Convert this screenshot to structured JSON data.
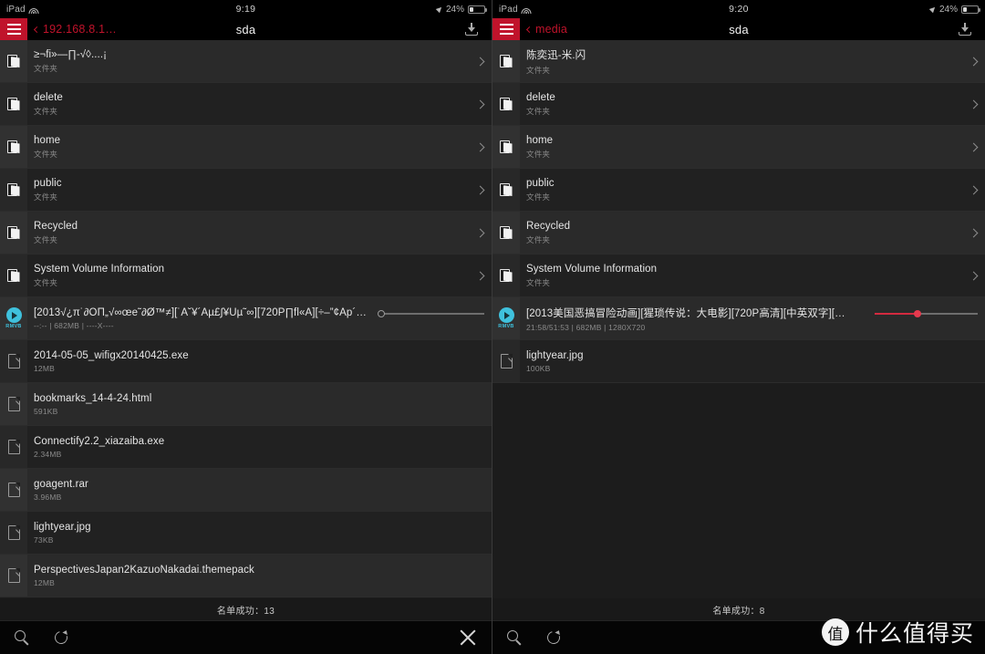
{
  "panels": [
    {
      "id": "left",
      "statusbar": {
        "device": "iPad",
        "wifi_icon": "wifi-icon",
        "time": "9:19",
        "location_icon": "location-arrow-icon",
        "battery_percent": "24%",
        "battery_level": 24
      },
      "navbar": {
        "menu_icon": "hamburger-menu-icon",
        "back_label": "192.168.8.1…",
        "title": "sda",
        "download_icon": "download-icon"
      },
      "rows": [
        {
          "type": "folder",
          "name": "≥¬fi»—∏-√◊....¡",
          "meta": "文件夹",
          "chevron": true
        },
        {
          "type": "folder",
          "name": "delete",
          "meta": "文件夹",
          "chevron": true
        },
        {
          "type": "folder",
          "name": "home",
          "meta": "文件夹",
          "chevron": true
        },
        {
          "type": "folder",
          "name": "public",
          "meta": "文件夹",
          "chevron": true
        },
        {
          "type": "folder",
          "name": "Recycled",
          "meta": "文件夹",
          "chevron": true
        },
        {
          "type": "folder",
          "name": "System Volume Information",
          "meta": "文件夹",
          "chevron": true
        },
        {
          "type": "video",
          "format": "RMVB",
          "name": "[2013√¿π˙∂ÒΠ„√∞œe˜∂Ø™≠][˙À˘¥´Àµ£∫¥Ûµ˜∞][720P∏fl«Â][÷–”¢Àp´…",
          "meta": "--:-- | 682MB | ----X----",
          "slider": {
            "active": false,
            "percent": 0
          }
        },
        {
          "type": "file",
          "name": "2014-05-05_wifigx20140425.exe",
          "meta": "12MB"
        },
        {
          "type": "file",
          "name": "bookmarks_14-4-24.html",
          "meta": "591KB"
        },
        {
          "type": "file",
          "name": "Connectify2.2_xiazaiba.exe",
          "meta": "2.34MB"
        },
        {
          "type": "file",
          "name": "goagent.rar",
          "meta": "3.96MB"
        },
        {
          "type": "file",
          "name": "lightyear.jpg",
          "meta": "73KB"
        },
        {
          "type": "file",
          "name": "PerspectivesJapan2KazuoNakadai.themepack",
          "meta": "12MB"
        }
      ],
      "status_strip": "名单成功：13",
      "toolbar": {
        "search_icon": "search-icon",
        "refresh_icon": "refresh-icon",
        "close_icon": "close-icon",
        "show_close": true
      }
    },
    {
      "id": "right",
      "statusbar": {
        "device": "iPad",
        "wifi_icon": "wifi-icon",
        "time": "9:20",
        "location_icon": "location-arrow-icon",
        "battery_percent": "24%",
        "battery_level": 24
      },
      "navbar": {
        "menu_icon": "hamburger-menu-icon",
        "back_label": "media",
        "title": "sda",
        "download_icon": "download-icon"
      },
      "rows": [
        {
          "type": "folder",
          "name": "陈奕迅-米.闪",
          "meta": "文件夹",
          "chevron": true
        },
        {
          "type": "folder",
          "name": "delete",
          "meta": "文件夹",
          "chevron": true
        },
        {
          "type": "folder",
          "name": "home",
          "meta": "文件夹",
          "chevron": true
        },
        {
          "type": "folder",
          "name": "public",
          "meta": "文件夹",
          "chevron": true
        },
        {
          "type": "folder",
          "name": "Recycled",
          "meta": "文件夹",
          "chevron": true
        },
        {
          "type": "folder",
          "name": "System Volume Information",
          "meta": "文件夹",
          "chevron": true
        },
        {
          "type": "video",
          "format": "RMVB",
          "name": "[2013美国恶搞冒险动画][猩琐传说：大电影][720P高清][中英双字][…",
          "meta": "21:58/51:53 | 682MB | 1280X720",
          "slider": {
            "active": true,
            "percent": 42
          }
        },
        {
          "type": "file",
          "name": "lightyear.jpg",
          "meta": "100KB"
        }
      ],
      "status_strip": "名单成功：8",
      "toolbar": {
        "search_icon": "search-icon",
        "refresh_icon": "refresh-icon",
        "close_icon": "close-icon",
        "show_close": false
      }
    }
  ],
  "watermark": {
    "badge": "值",
    "text": "什么值得买"
  },
  "colors": {
    "accent_red": "#c0132b",
    "slider_red": "#d32a3f",
    "video_cyan": "#3fc1dd",
    "row_odd": "#2a2a2a",
    "row_even": "#212121"
  }
}
